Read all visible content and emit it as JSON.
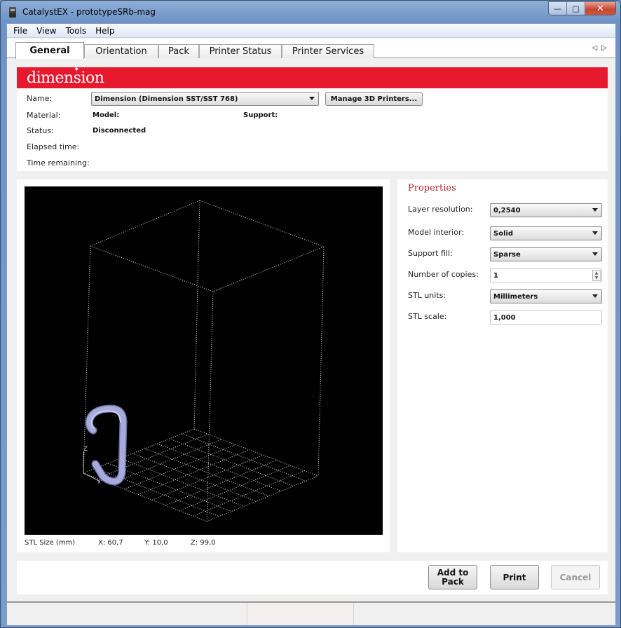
{
  "window": {
    "title": "CatalystEX - prototypeSRb-mag",
    "controls": {
      "minimize": "—",
      "maximize": "□",
      "close": "✕"
    }
  },
  "menu": [
    "File",
    "View",
    "Tools",
    "Help"
  ],
  "tabs": [
    {
      "label": "General",
      "active": true
    },
    {
      "label": "Orientation",
      "active": false
    },
    {
      "label": "Pack",
      "active": false
    },
    {
      "label": "Printer Status",
      "active": false
    },
    {
      "label": "Printer Services",
      "active": false
    }
  ],
  "tab_scroll": {
    "left": "◁",
    "right": "▷"
  },
  "brand": {
    "logo_text": "dimension",
    "logo_mark": "✦",
    "banner_color": "#e8192f"
  },
  "printer": {
    "name_label": "Name:",
    "name_value": "Dimension  (Dimension SST/SST 768)",
    "manage_button": "Manage 3D Printers...",
    "material_label": "Material:",
    "model_label": "Model:",
    "support_label": "Support:",
    "status_label": "Status:",
    "status_value": "Disconnected",
    "elapsed_label": "Elapsed time:",
    "remaining_label": "Time remaining:"
  },
  "viewer": {
    "axis_label_z": "Z",
    "axis_label_x": "X",
    "stl_size_label": "STL Size (mm)",
    "x": "X:  60,7",
    "y": "Y:  10,0",
    "z": "Z:  99,0",
    "model_color": "#a8aadc"
  },
  "properties": {
    "title": "Properties",
    "title_color": "#b22828",
    "layer_resolution": {
      "label": "Layer resolution:",
      "value": "0,2540"
    },
    "model_interior": {
      "label": "Model interior:",
      "value": "Solid"
    },
    "support_fill": {
      "label": "Support fill:",
      "value": "Sparse"
    },
    "copies": {
      "label": "Number of copies:",
      "value": "1"
    },
    "stl_units": {
      "label": "STL units:",
      "value": "Millimeters"
    },
    "stl_scale": {
      "label": "STL scale:",
      "value": "1,000"
    }
  },
  "actions": {
    "add_to_pack": "Add to Pack",
    "print": "Print",
    "cancel": "Cancel"
  }
}
